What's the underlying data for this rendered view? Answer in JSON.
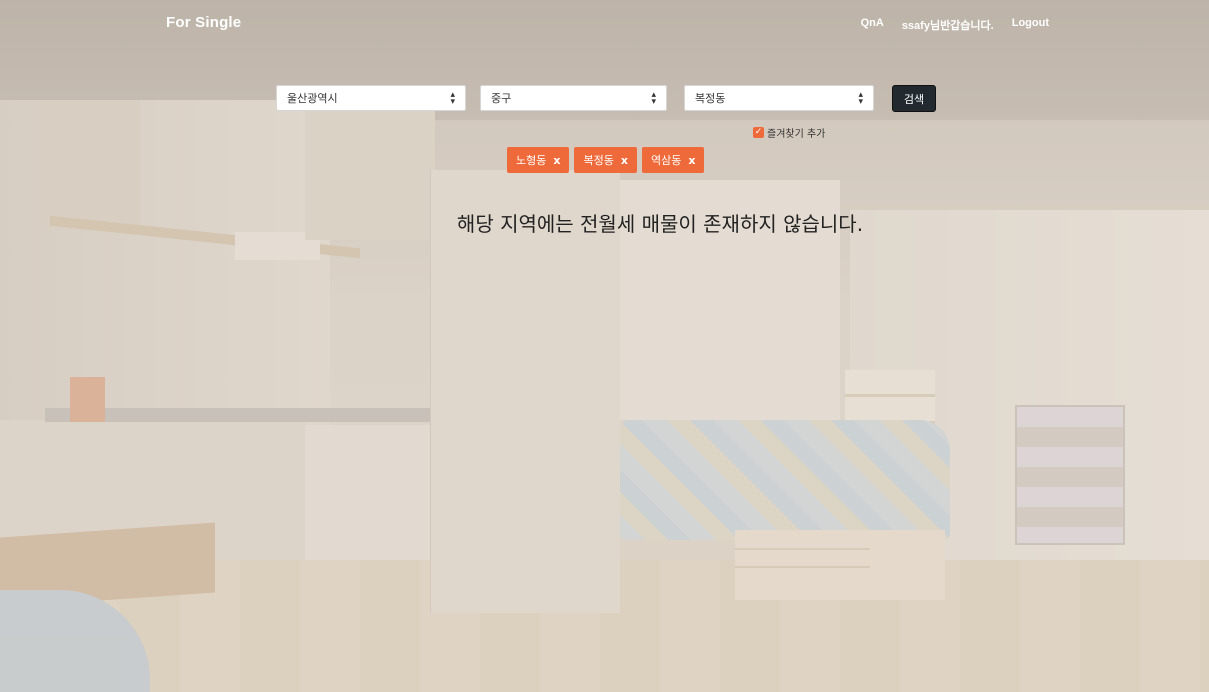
{
  "nav": {
    "brand": "For Single",
    "links": [
      "QnA",
      "ssafy님반갑습니다.",
      "Logout"
    ]
  },
  "search": {
    "city": "울산광역시",
    "gu": "중구",
    "dong": "복정동",
    "button_label": "검색",
    "favorite_label": "즐겨찾기 추가",
    "favorite_checked": true
  },
  "tags": [
    {
      "label": "노형동",
      "remove": "x"
    },
    {
      "label": "복정동",
      "remove": "x"
    },
    {
      "label": "역삼동",
      "remove": "x"
    }
  ],
  "message": "해당 지역에는 전월세 매물이 존재하지 않습니다.",
  "colors": {
    "accent": "#ef6a3a",
    "button_dark": "#222a30"
  },
  "icons": {
    "select_caret": "updown-caret-icon",
    "favorite": "checkbox-checked-icon"
  }
}
